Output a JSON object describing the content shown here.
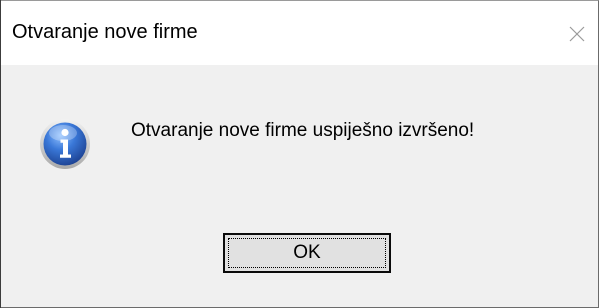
{
  "dialog": {
    "title": "Otvaranje nove firme",
    "message": "Otvaranje nove firme uspiješno izvršeno!",
    "icon": "information-icon",
    "ok_label": "OK",
    "close_icon": "close-icon"
  },
  "colors": {
    "titlebar_bg": "#ffffff",
    "client_bg": "#f0f0f0",
    "button_bg": "#e1e1e1",
    "icon_blue": "#2a5fb8"
  }
}
